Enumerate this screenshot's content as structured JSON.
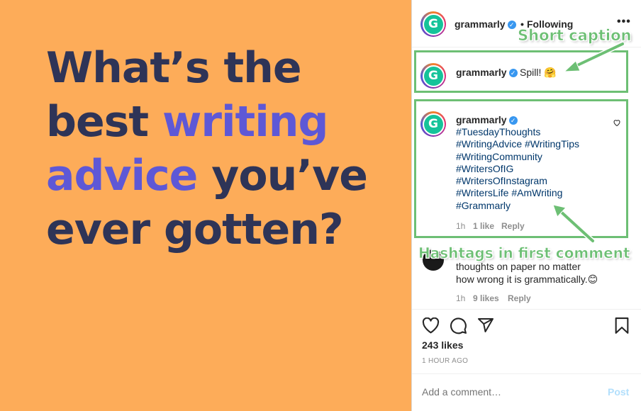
{
  "post_image": {
    "line1": "What’s the",
    "line2_a": "best ",
    "line2_b": "writing",
    "line3_a": "advice",
    "line3_b": " you’ve",
    "line4": "ever gotten?",
    "colors": {
      "background": "#fdac59",
      "text": "#2e3457",
      "highlight": "#5e58d6"
    }
  },
  "header": {
    "avatar_letter": "G",
    "username": "grammarly",
    "separator": "•",
    "follow_status": "Following",
    "more": "•••"
  },
  "caption": {
    "avatar_letter": "G",
    "username": "grammarly",
    "text": "Spill! 🤗"
  },
  "first_comment": {
    "avatar_letter": "G",
    "username": "grammarly",
    "hashtags": [
      "#TuesdayThoughts",
      "#WritingAdvice #WritingTips",
      "#WritingCommunity",
      "#WritersOfIG",
      "#WritersOfInstagram",
      "#WritersLife #AmWriting",
      "#Grammarly"
    ],
    "time": "1h",
    "likes": "1 like",
    "reply": "Reply"
  },
  "second_comment": {
    "line1": "thoughts on paper no matter",
    "line2": "how wrong it is grammatically.😊",
    "time": "1h",
    "likes": "9 likes",
    "reply": "Reply"
  },
  "actions": {
    "like_icon": "heart-icon",
    "comment_icon": "comment-icon",
    "share_icon": "paper-plane-icon",
    "save_icon": "bookmark-icon"
  },
  "likes_count": "243 likes",
  "time_ago": "1 HOUR AGO",
  "add_comment": {
    "placeholder": "Add a comment…",
    "post_label": "Post"
  },
  "annotations": {
    "short_caption": "Short caption",
    "hashtags_note": "Hashtags in first comment",
    "color": "#6dbf74"
  }
}
